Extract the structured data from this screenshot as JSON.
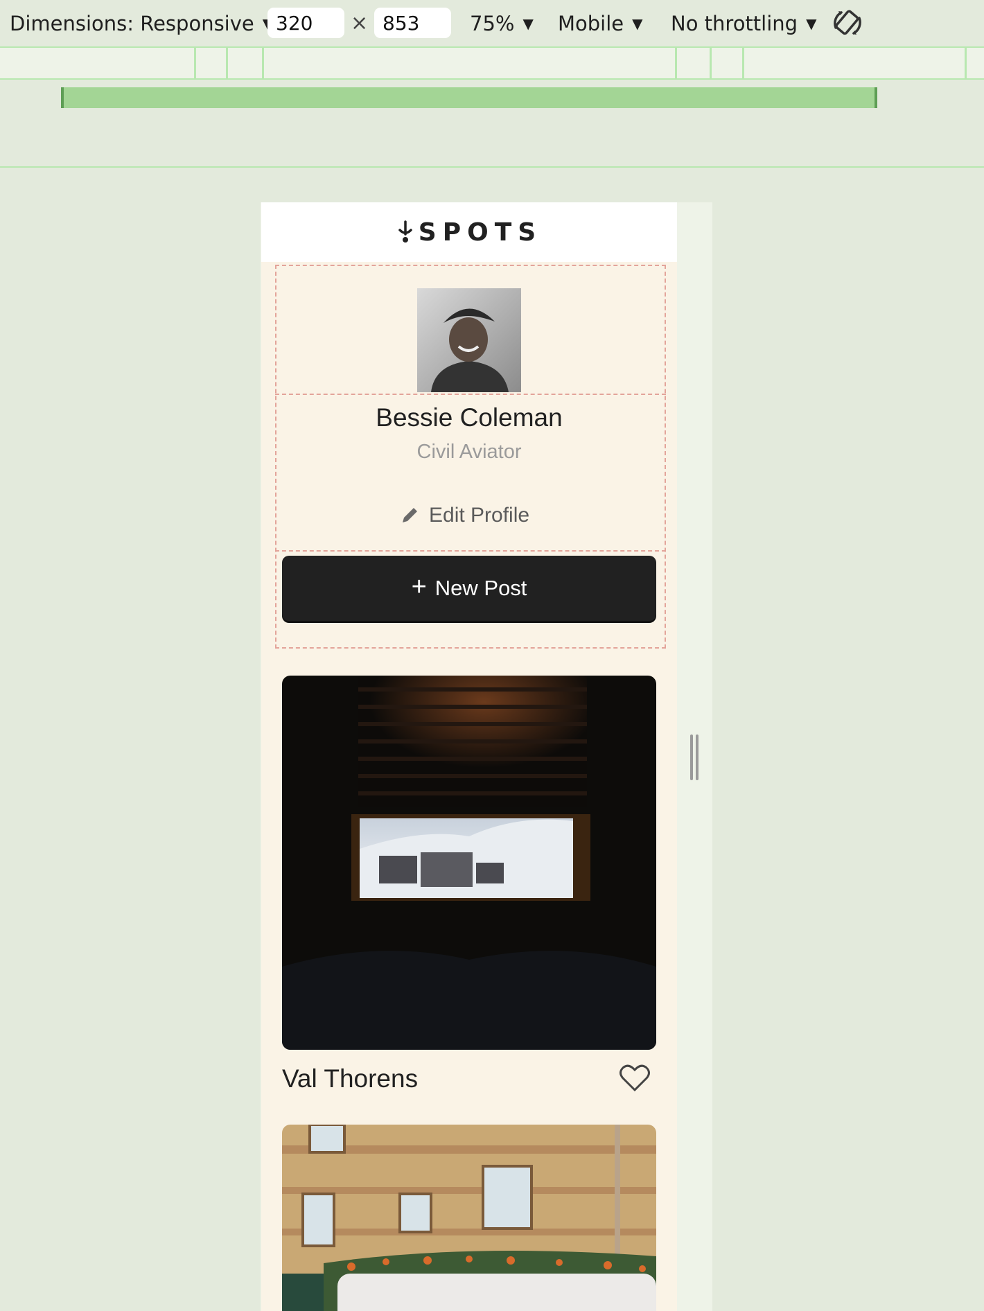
{
  "devtools": {
    "dimensions_label": "Dimensions: Responsive",
    "width_value": "320",
    "height_value": "853",
    "times_symbol": "×",
    "zoom": "75%",
    "device_type": "Mobile",
    "throttling": "No throttling",
    "caret": "▼"
  },
  "site": {
    "logo_text": "SPOTS"
  },
  "profile": {
    "name": "Bessie Coleman",
    "role": "Civil Aviator",
    "edit_label": "Edit Profile",
    "new_post_label": "New Post",
    "new_post_icon": "+"
  },
  "cards": [
    {
      "title": "Val Thorens"
    },
    {
      "title": ""
    }
  ],
  "colors": {
    "page_bg": "#e3eadc",
    "accent_green": "#a3d595",
    "site_bg": "#faf3e6",
    "button_dark": "#212121"
  }
}
